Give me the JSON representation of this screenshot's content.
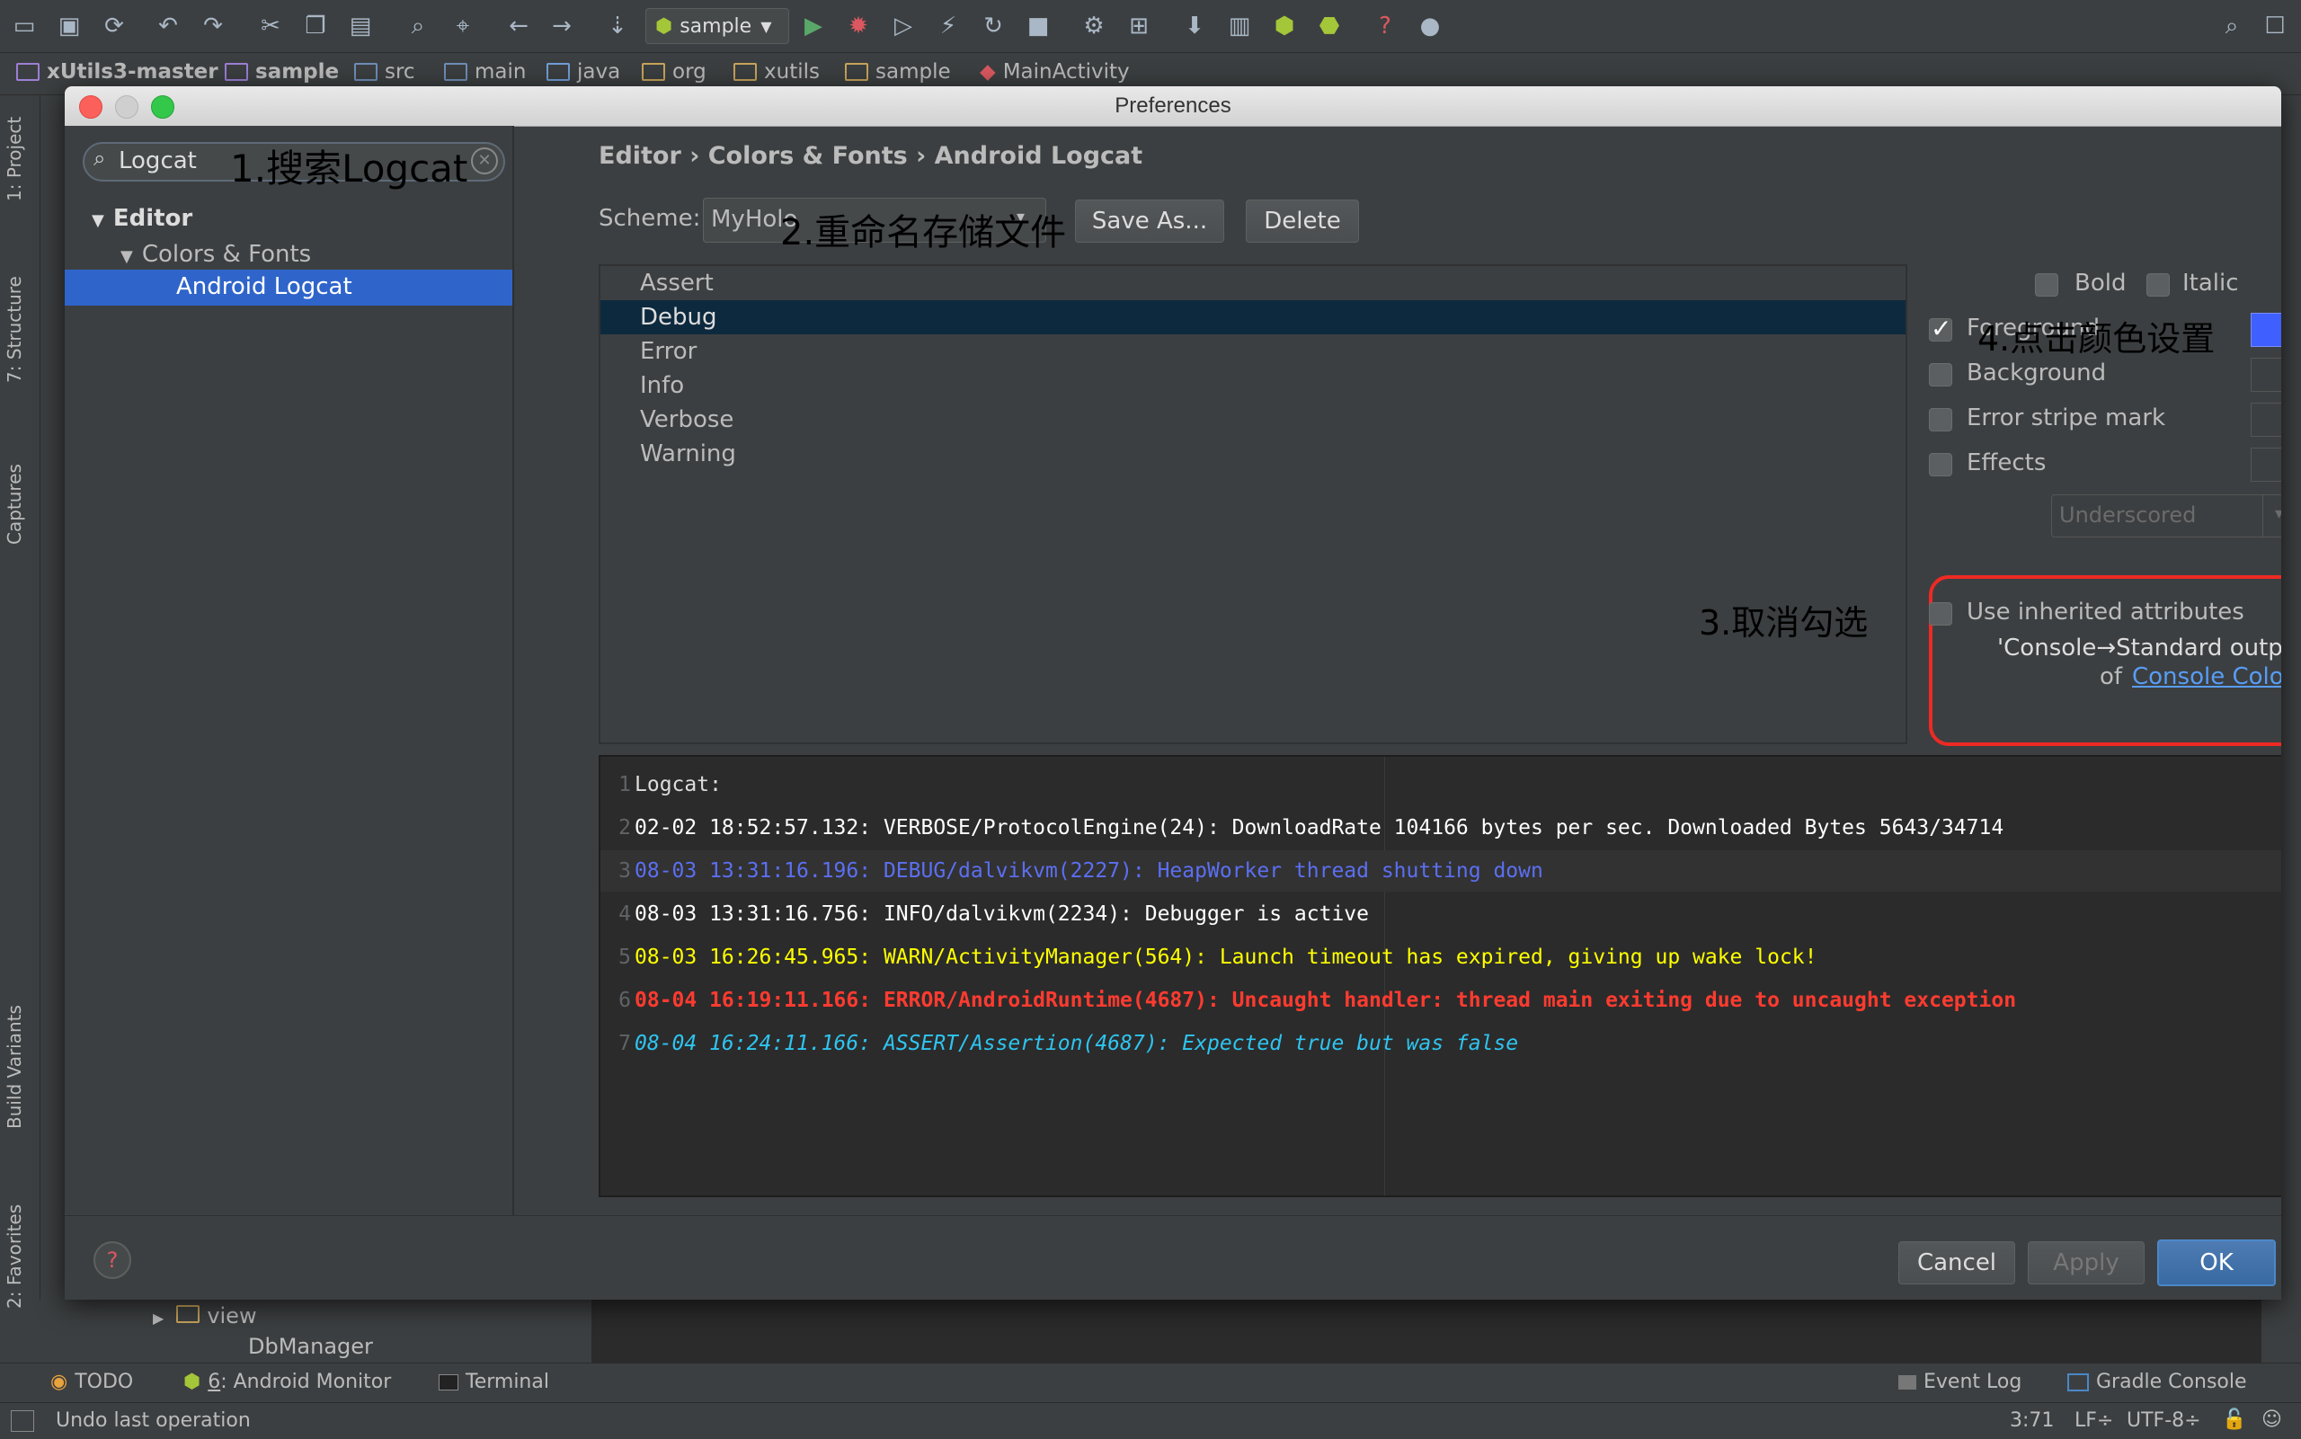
{
  "toolbar": {
    "run_config": "sample",
    "icons": [
      "open-icon",
      "save-icon",
      "sync-icon",
      "undo-icon",
      "redo-icon",
      "cut-icon",
      "copy-icon",
      "paste-icon",
      "find-icon",
      "replace-icon",
      "back-icon",
      "forward-icon",
      "make-icon",
      "run-icon",
      "debug-icon",
      "attach-icon",
      "apply-changes-icon",
      "rerun-icon",
      "stop-icon",
      "settings-icon",
      "project-structure-icon",
      "avd-icon",
      "sdk-icon",
      "sync-gradle-icon",
      "android-icon",
      "help-icon",
      "monitor-icon",
      "search-everywhere-icon",
      "user-icon"
    ]
  },
  "breadcrumb": [
    "xUtils3-master",
    "sample",
    "src",
    "main",
    "java",
    "org",
    "xutils",
    "sample",
    "MainActivity"
  ],
  "left_strip": [
    "1: Project",
    "7: Structure",
    "Captures",
    "Build Variants",
    "2: Favorites"
  ],
  "dialog": {
    "title": "Preferences",
    "search_value": "Logcat",
    "tree": {
      "editor": "Editor",
      "colors_fonts": "Colors & Fonts",
      "android_logcat": "Android Logcat"
    },
    "path": "Editor › Colors & Fonts › Android Logcat",
    "scheme_label": "Scheme:",
    "scheme_value": "MyHolo",
    "save_as": "Save As...",
    "delete": "Delete",
    "tags": [
      "Assert",
      "Debug",
      "Error",
      "Info",
      "Verbose",
      "Warning"
    ],
    "selected_tag": "Debug",
    "bold": "Bold",
    "italic": "Italic",
    "foreground": "Foreground",
    "foreground_color": "#3f5fff",
    "background": "Background",
    "error_stripe": "Error stripe mark",
    "effects": "Effects",
    "effect_type": "Underscored",
    "use_inherited": "Use inherited attributes",
    "inherited_from": "'Console→Standard output'",
    "inherited_of": "of",
    "console_colors_link": "Console Colors",
    "preview": [
      {
        "n": "1",
        "text": "Logcat:",
        "color": "#dddddd",
        "style": "normal"
      },
      {
        "n": "2",
        "text": "02-02 18:52:57.132: VERBOSE/ProtocolEngine(24): DownloadRate 104166 bytes per sec. Downloaded Bytes 5643/34714",
        "color": "#ffffff",
        "style": "normal"
      },
      {
        "n": "3",
        "text": "08-03 13:31:16.196: DEBUG/dalvikvm(2227): HeapWorker thread shutting down",
        "color": "#5c6ff2",
        "style": "normal"
      },
      {
        "n": "4",
        "text": "08-03 13:31:16.756: INFO/dalvikvm(2234): Debugger is active",
        "color": "#ffffff",
        "style": "normal"
      },
      {
        "n": "5",
        "text": "08-03 16:26:45.965: WARN/ActivityManager(564): Launch timeout has expired, giving up wake lock!",
        "color": "#ffff00",
        "style": "normal"
      },
      {
        "n": "6",
        "text": "08-04 16:19:11.166: ERROR/AndroidRuntime(4687): Uncaught handler: thread main exiting due to uncaught exception",
        "color": "#ff3b30",
        "style": "bold"
      },
      {
        "n": "7",
        "text": "08-04 16:24:11.166: ASSERT/Assertion(4687): Expected true but was false",
        "color": "#2ec5f0",
        "style": "italic"
      }
    ],
    "cancel": "Cancel",
    "apply": "Apply",
    "ok": "OK"
  },
  "annotations": {
    "a1": "1.搜索Logcat",
    "a2": "2.重命名存储文件",
    "a3": "3.取消勾选",
    "a4": "4.点击颜色设置"
  },
  "background_editor": {
    "view": "view",
    "db_manager": "DbManager"
  },
  "bottom_tabs": {
    "todo": "TODO",
    "monitor_num": "6",
    "monitor": ": Android Monitor",
    "terminal": "Terminal",
    "event_log": "Event Log",
    "gradle_console": "Gradle Console"
  },
  "status": {
    "message": "Undo last operation",
    "position": "3:71",
    "line_sep": "LF÷",
    "encoding": "UTF-8÷"
  }
}
